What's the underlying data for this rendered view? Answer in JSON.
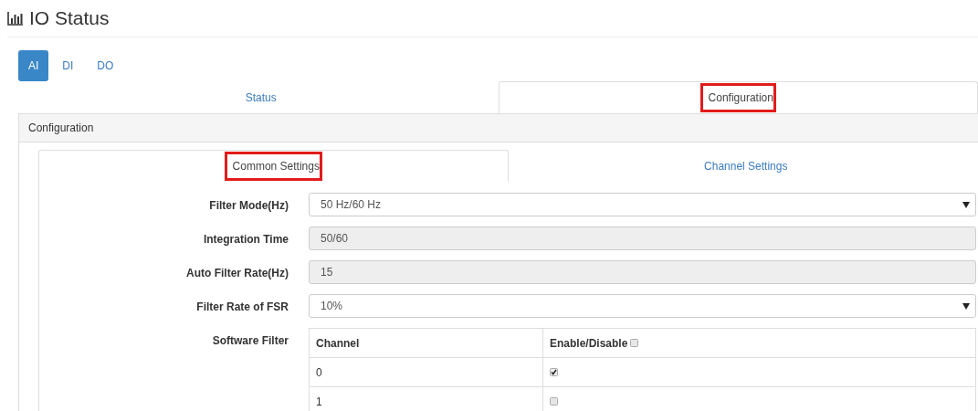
{
  "page": {
    "title": "IO Status"
  },
  "io_tabs": [
    {
      "label": "AI",
      "selected": true
    },
    {
      "label": "DI",
      "selected": false
    },
    {
      "label": "DO",
      "selected": false
    }
  ],
  "view_tabs": [
    {
      "label": "Status",
      "selected": false,
      "highlighted": false
    },
    {
      "label": "Configuration",
      "selected": true,
      "highlighted": true
    }
  ],
  "panel": {
    "title": "Configuration"
  },
  "settings_tabs": [
    {
      "label": "Common Settings",
      "selected": true,
      "highlighted": true
    },
    {
      "label": "Channel Settings",
      "selected": false,
      "highlighted": false
    }
  ],
  "fields": [
    {
      "kind": "select",
      "label": "Filter Mode(Hz)",
      "value": "50 Hz/60 Hz",
      "disabled": false
    },
    {
      "kind": "text",
      "label": "Integration Time",
      "value": "50/60",
      "disabled": true
    },
    {
      "kind": "text",
      "label": "Auto Filter Rate(Hz)",
      "value": "15",
      "disabled": true
    },
    {
      "kind": "select",
      "label": "Filter Rate of FSR",
      "value": "10%",
      "disabled": false
    }
  ],
  "software_filter": {
    "label": "Software Filter",
    "columns": [
      "Channel",
      "Enable/Disable"
    ],
    "all_checked": false,
    "rows": [
      {
        "channel": "0",
        "checked": true
      },
      {
        "channel": "1",
        "checked": false
      }
    ]
  }
}
